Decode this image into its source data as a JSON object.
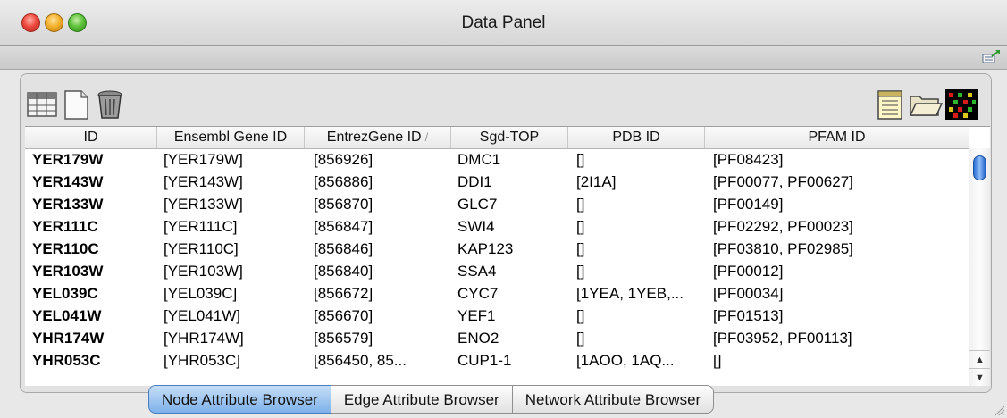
{
  "window": {
    "title": "Data Panel"
  },
  "table": {
    "columns": [
      {
        "label": "ID"
      },
      {
        "label": "Ensembl Gene ID"
      },
      {
        "label": "EntrezGene ID",
        "sort": "ascending"
      },
      {
        "label": "Sgd-TOP"
      },
      {
        "label": "PDB ID"
      },
      {
        "label": "PFAM ID"
      }
    ],
    "rows": [
      [
        "YER179W",
        "[YER179W]",
        "[856926]",
        "DMC1",
        "[]",
        "[PF08423]"
      ],
      [
        "YER143W",
        "[YER143W]",
        "[856886]",
        "DDI1",
        "[2I1A]",
        "[PF00077, PF00627]"
      ],
      [
        "YER133W",
        "[YER133W]",
        "[856870]",
        "GLC7",
        "[]",
        "[PF00149]"
      ],
      [
        "YER111C",
        "[YER111C]",
        "[856847]",
        "SWI4",
        "[]",
        "[PF02292, PF00023]"
      ],
      [
        "YER110C",
        "[YER110C]",
        "[856846]",
        "KAP123",
        "[]",
        "[PF03810, PF02985]"
      ],
      [
        "YER103W",
        "[YER103W]",
        "[856840]",
        "SSA4",
        "[]",
        "[PF00012]"
      ],
      [
        "YEL039C",
        "[YEL039C]",
        "[856672]",
        "CYC7",
        "[1YEA, 1YEB,...",
        "[PF00034]"
      ],
      [
        "YEL041W",
        "[YEL041W]",
        "[856670]",
        "YEF1",
        "[]",
        "[PF01513]"
      ],
      [
        "YHR174W",
        "[YHR174W]",
        "[856579]",
        "ENO2",
        "[]",
        "[PF03952, PF00113]"
      ],
      [
        "YHR053C",
        "[YHR053C]",
        "[856450, 85...",
        "CUP1-1",
        "[1AOO, 1AQ...",
        "[]"
      ]
    ]
  },
  "tabs": [
    {
      "label": "Node Attribute Browser",
      "active": true
    },
    {
      "label": "Edge Attribute Browser",
      "active": false
    },
    {
      "label": "Network Attribute Browser",
      "active": false
    }
  ],
  "toolbar": {
    "left_icons": [
      "grid-select-icon",
      "new-document-icon",
      "trash-icon"
    ],
    "right_icons": [
      "attribute-list-icon",
      "open-folder-icon",
      "heatmap-icon"
    ]
  },
  "scrollbar": {
    "up_glyph": "▲",
    "down_glyph": "▼"
  }
}
